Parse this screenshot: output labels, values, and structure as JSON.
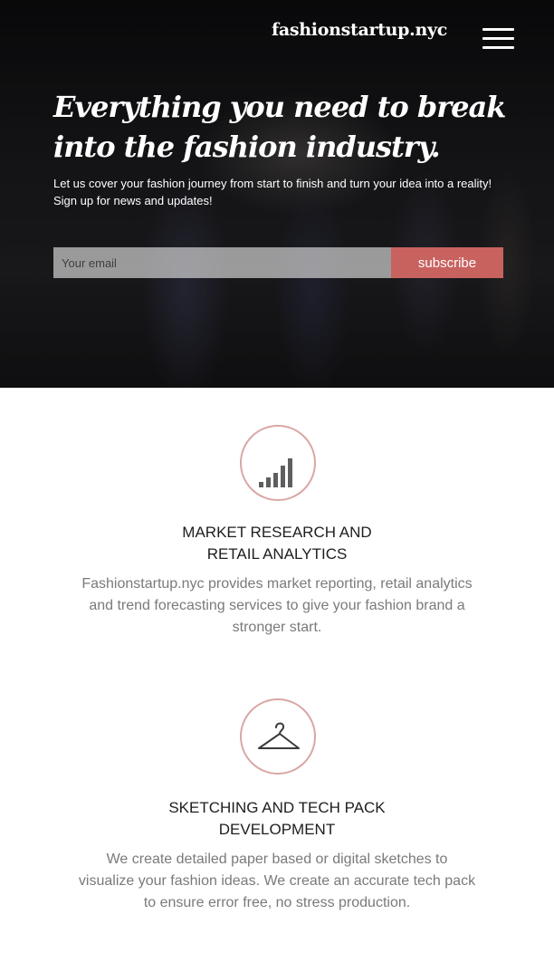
{
  "header": {
    "logo": "fashionstartup.nyc",
    "menu_icon": "hamburger-menu-icon"
  },
  "hero": {
    "headline_line1": "Everything you need to break",
    "headline_line2": "into the fashion industry.",
    "intro": "Let us cover your fashion journey from start to finish and turn your idea into a reality!",
    "signup": "Sign up for news and updates!",
    "email_placeholder": "Your email",
    "subscribe_label": "subscribe"
  },
  "services": [
    {
      "icon": "bar-chart-icon",
      "title_line1": "MARKET RESEARCH AND",
      "title_line2": "RETAIL ANALYTICS",
      "description": "Fashionstartup.nyc provides market reporting, retail analytics and trend forecasting services to give your fashion brand a stronger start."
    },
    {
      "icon": "hanger-icon",
      "title_line1": "SKETCHING AND TECH PACK",
      "title_line2": "DEVELOPMENT",
      "description": "We create detailed paper based or digital sketches to visualize your fashion ideas. We create an accurate tech pack to ensure error free, no stress production."
    }
  ],
  "colors": {
    "accent": "#c8625f",
    "icon_ring": "#d9a7a4",
    "body_text": "#7a7a7a"
  }
}
